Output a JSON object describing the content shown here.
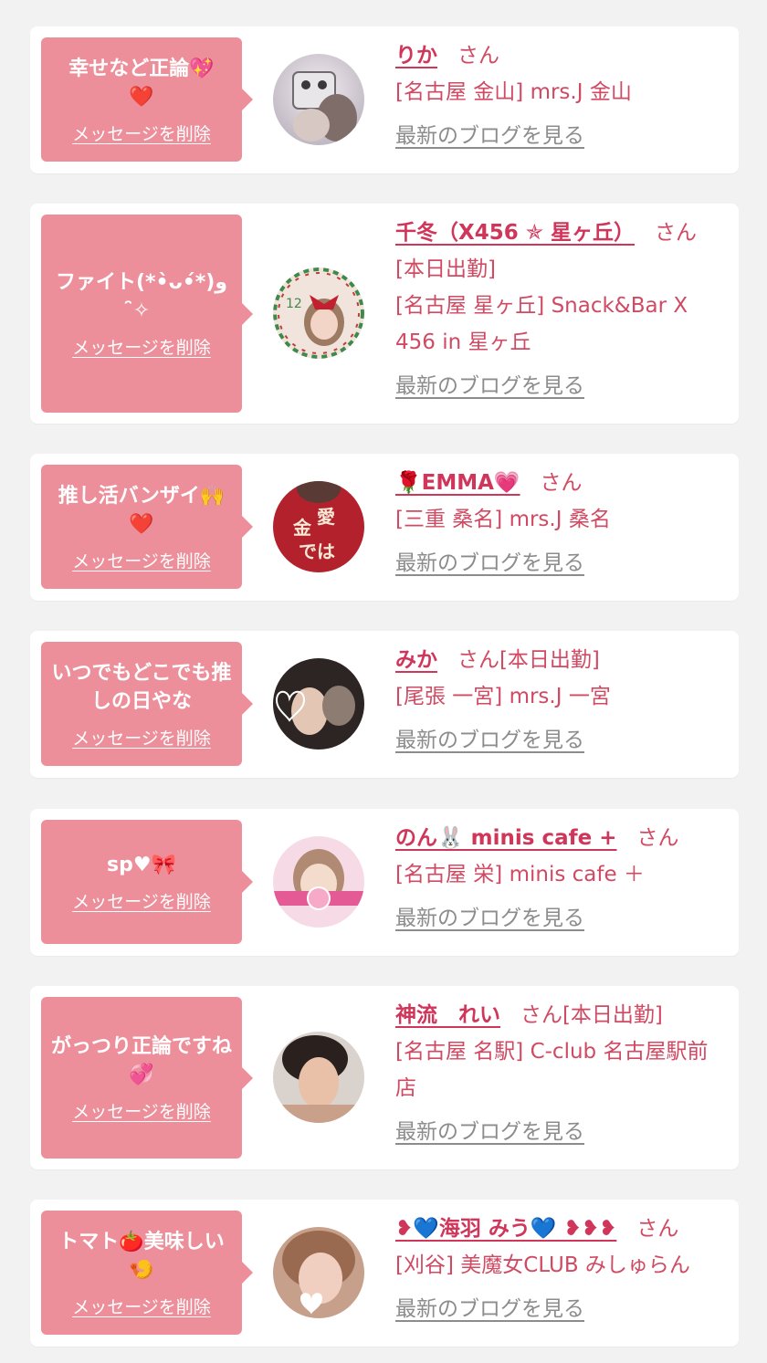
{
  "colors": {
    "page_bg": "#f2f2f3",
    "card_bg": "#ffffff",
    "bubble_bg": "#ec8f9a",
    "name_color": "#d0365a",
    "shop_color": "#d04a63",
    "blog_link_color": "#8c8c8c"
  },
  "delete_label": "メッセージを削除",
  "blog_label": "最新のブログを見る",
  "entries": [
    {
      "message": "幸せなど正論💖",
      "message_extra": "❤️",
      "name": "りか",
      "suffix": "さん",
      "shop": "[名古屋 金山] mrs.J 金山",
      "avatar_icon": "avatar-photo"
    },
    {
      "message": "ファイト(*•̀ᴗ•́*)و ̑̑✧",
      "message_extra": "",
      "name": "千冬（X456 ✯ 星ヶ丘）",
      "suffix": "さん[本日出勤]",
      "shop": "[名古屋 星ヶ丘] Snack&Bar X 456 in 星ヶ丘",
      "avatar_icon": "avatar-photo"
    },
    {
      "message": "推し活バンザイ🙌",
      "message_extra": "❤️",
      "name": "🌹EMMA💗",
      "suffix": "さん",
      "shop": "[三重 桑名] mrs.J 桑名",
      "avatar_icon": "avatar-photo"
    },
    {
      "message": "いつでもどこでも推しの日やな",
      "message_extra": "",
      "name": "みか",
      "suffix": "さん[本日出勤]",
      "shop": "[尾張 一宮] mrs.J 一宮",
      "avatar_icon": "avatar-photo"
    },
    {
      "message": "sp♥🎀",
      "message_extra": "",
      "name": "のん🐰 minis cafe +",
      "suffix": "さん",
      "shop": "[名古屋 栄] minis cafe ＋",
      "avatar_icon": "avatar-photo"
    },
    {
      "message": "がっつり正論ですね💞",
      "message_extra": "",
      "name": "神流　れい",
      "suffix": "さん[本日出勤]",
      "shop": "[名古屋 名駅] C-club 名古屋駅前店",
      "avatar_icon": "avatar-photo"
    },
    {
      "message": "トマト🍅美味しい",
      "message_extra": "🍤",
      "name": "❥💙海羽 みう💙 ❥❥❥",
      "suffix": "さん",
      "shop": "[刈谷] 美魔女CLUB みしゅらん",
      "avatar_icon": "avatar-photo"
    }
  ]
}
